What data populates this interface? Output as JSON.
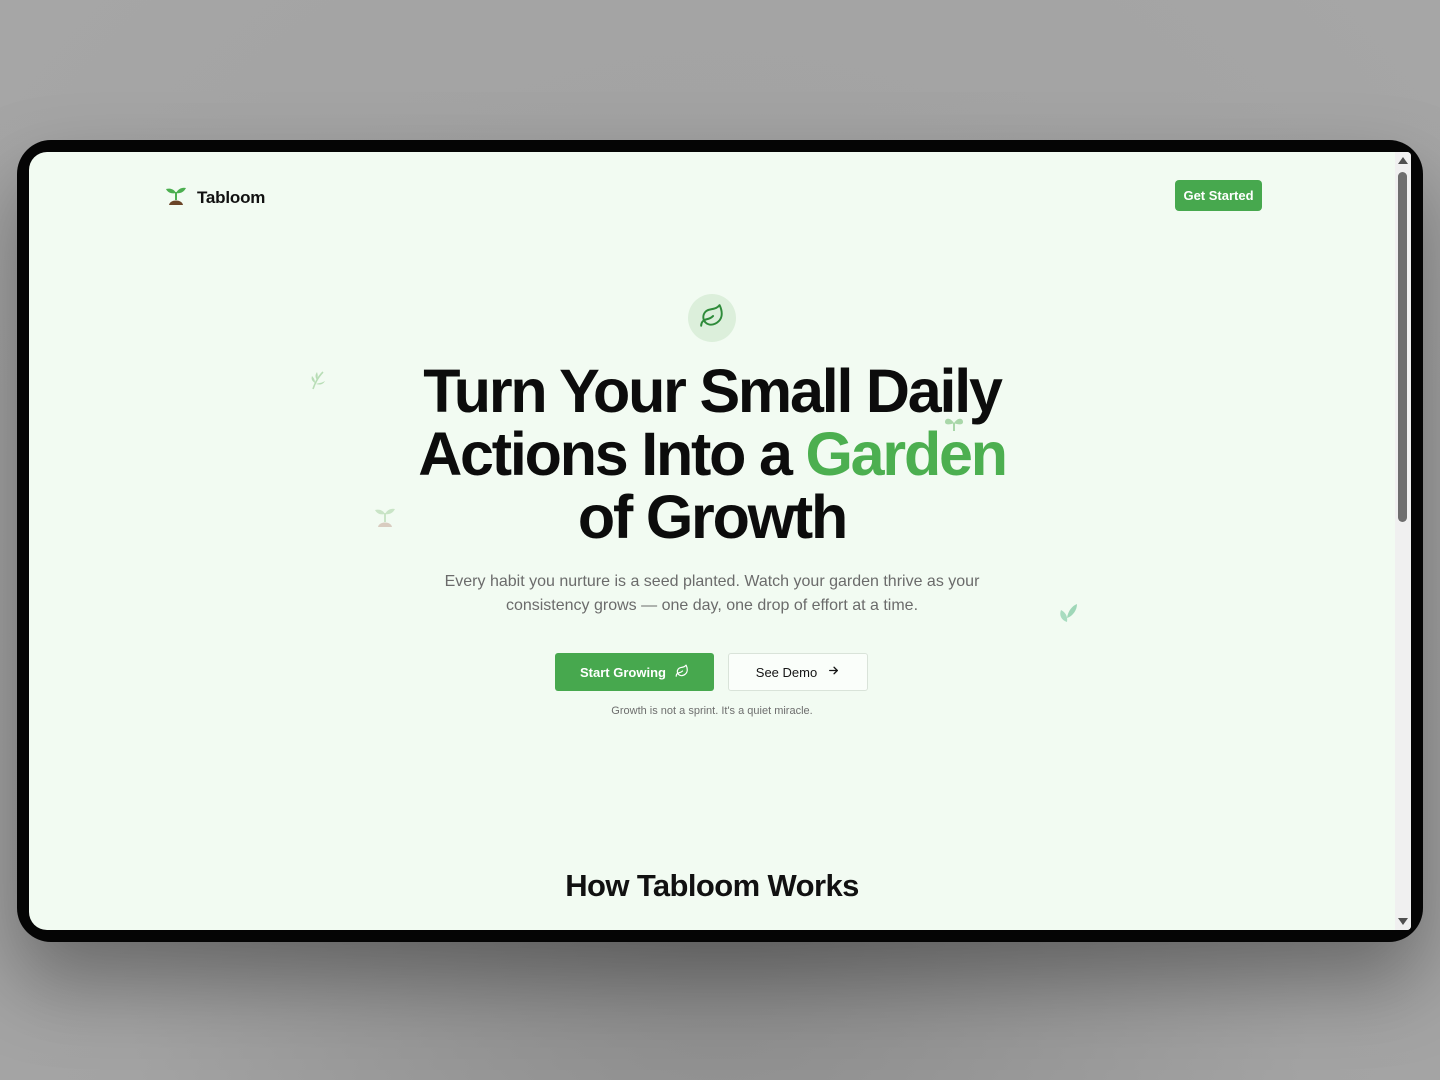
{
  "brand": {
    "name": "Tabloom"
  },
  "nav": {
    "cta_label": "Get Started"
  },
  "hero": {
    "headline_line1": "Turn Your Small Daily",
    "headline_line2_prefix": "Actions Into a ",
    "headline_highlight": "Garden",
    "headline_line3": "of Growth",
    "subtitle": "Every habit you nurture is a seed planted. Watch your garden thrive as your consistency grows — one day, one drop of effort at a time.",
    "primary_button": "Start Growing",
    "secondary_button": "See Demo",
    "tagline": "Growth is not a sprint. It's a quiet miracle."
  },
  "section": {
    "title": "How Tabloom Works"
  },
  "colors": {
    "accent": "#4caf50",
    "button": "#47a84e",
    "background": "#f2fbf2",
    "text": "#0c0c0c"
  },
  "icons": {
    "logo": "sprout-icon",
    "hero_badge": "leaf-icon",
    "primary_button": "leaf-icon",
    "secondary_button": "arrow-right-icon"
  }
}
